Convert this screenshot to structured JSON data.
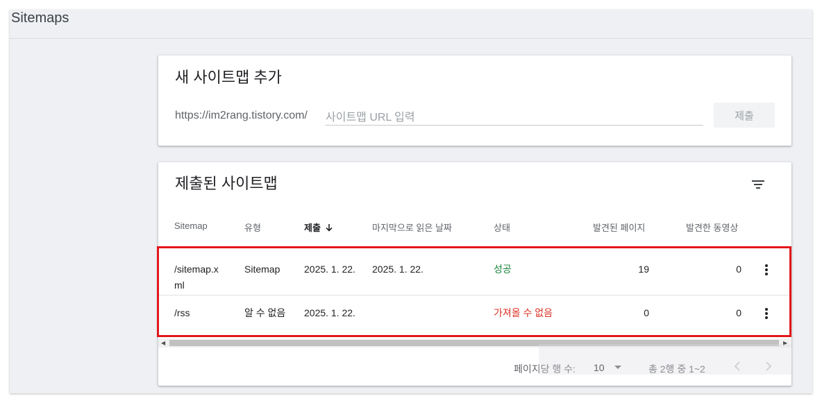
{
  "page": {
    "title": "Sitemaps"
  },
  "add_card": {
    "title": "새 사이트맵 추가",
    "url_prefix": "https://im2rang.tistory.com/",
    "input_placeholder": "사이트맵 URL 입력",
    "input_value": "",
    "submit_label": "제출"
  },
  "list_card": {
    "title": "제출된 사이트맵",
    "filter_icon": "filter-list-icon",
    "columns": {
      "sitemap": "Sitemap",
      "type": "유형",
      "submitted": "제출",
      "last_read": "마지막으로 읽은 날짜",
      "status": "상태",
      "pages": "발견된 페이지",
      "videos": "발견한 동영상"
    },
    "sort_column": "submitted",
    "sort_direction": "descending",
    "rows": [
      {
        "sitemap_line1": "/sitemap.x",
        "sitemap_line2": "ml",
        "type": "Sitemap",
        "submitted": "2025. 1. 22.",
        "last_read": "2025. 1. 22.",
        "status": "성공",
        "pages": "19",
        "videos": "0"
      },
      {
        "sitemap_line1": "/rss",
        "sitemap_line2": "",
        "type": "알 수 없음",
        "submitted": "2025. 1. 22.",
        "last_read": "",
        "status": "가져올 수 없음",
        "pages": "0",
        "videos": "0"
      }
    ],
    "pagination": {
      "rows_per_page_label": "페이지당 행 수:",
      "rows_per_page_value": "10",
      "range_label": "총 2행 중 1~2"
    }
  },
  "colors": {
    "status_success": "#188038",
    "status_error": "#d93025",
    "highlight_box": "#e3161b"
  }
}
